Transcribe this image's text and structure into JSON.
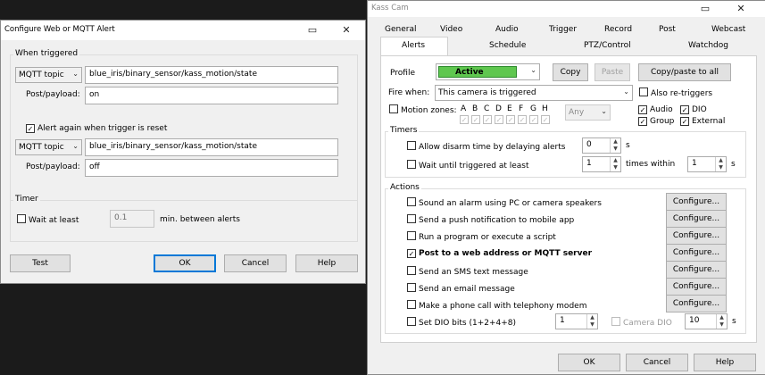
{
  "left_dialog": {
    "title": "Configure Web or MQTT Alert",
    "when_triggered_label": "When triggered",
    "combo1": "MQTT topic",
    "topic1": "blue_iris/binary_sensor/kass_motion/state",
    "payload_label1": "Post/payload:",
    "payload1": "on",
    "alert_again_label": "Alert again when trigger is reset",
    "combo2": "MQTT topic",
    "topic2": "blue_iris/binary_sensor/kass_motion/state",
    "payload_label2": "Post/payload:",
    "payload2": "off",
    "timer_label": "Timer",
    "wait_label": "Wait at least",
    "wait_value": "0.1",
    "wait_units": "min. between alerts",
    "test_btn": "Test",
    "ok_btn": "OK",
    "cancel_btn": "Cancel",
    "help_btn": "Help"
  },
  "right_dialog": {
    "title": "Kass Cam",
    "tabs_top": [
      "General",
      "Video",
      "Audio",
      "Trigger",
      "Record",
      "Post",
      "Webcast"
    ],
    "tabs_bottom": [
      "Alerts",
      "Schedule",
      "PTZ/Control",
      "Watchdog"
    ],
    "profile_label": "Profile",
    "profile_value": "Active",
    "copy_btn": "Copy",
    "paste_btn": "Paste",
    "copy_paste_all_btn": "Copy/paste to all",
    "fire_when_label": "Fire when:",
    "fire_when_value": "This camera is triggered",
    "also_retriggers": "Also re-triggers",
    "motion_zones_label": "Motion zones:",
    "zones": [
      "A",
      "B",
      "C",
      "D",
      "E",
      "F",
      "G",
      "H"
    ],
    "any_value": "Any",
    "audio_label": "Audio",
    "dio_label": "DIO",
    "group_label": "Group",
    "external_label": "External",
    "timers_label": "Timers",
    "disarm_label": "Allow disarm time by delaying alerts",
    "disarm_value": "0",
    "disarm_units": "s",
    "wait_trigger_label": "Wait until triggered at least",
    "wait_trigger_value": "1",
    "times_within": "times within",
    "times_value": "1",
    "times_units": "s",
    "actions_label": "Actions",
    "actions": [
      {
        "label": "Sound an alarm using PC or camera speakers",
        "checked": false
      },
      {
        "label": "Send a push notification to mobile app",
        "checked": false
      },
      {
        "label": "Run a program or execute a script",
        "checked": false
      },
      {
        "label": "Post to a web address or MQTT server",
        "checked": true
      },
      {
        "label": "Send an SMS text message",
        "checked": false
      },
      {
        "label": "Send an email message",
        "checked": false
      },
      {
        "label": "Make a phone call with telephony modem",
        "checked": false
      }
    ],
    "configure_label": "Configure...",
    "dio_bits_label": "Set DIO bits (1+2+4+8)",
    "dio_bits_value": "1",
    "camera_dio_label": "Camera DIO",
    "camera_dio_value": "10",
    "camera_dio_units": "s",
    "ok_btn": "OK",
    "cancel_btn": "Cancel",
    "help_btn": "Help"
  }
}
